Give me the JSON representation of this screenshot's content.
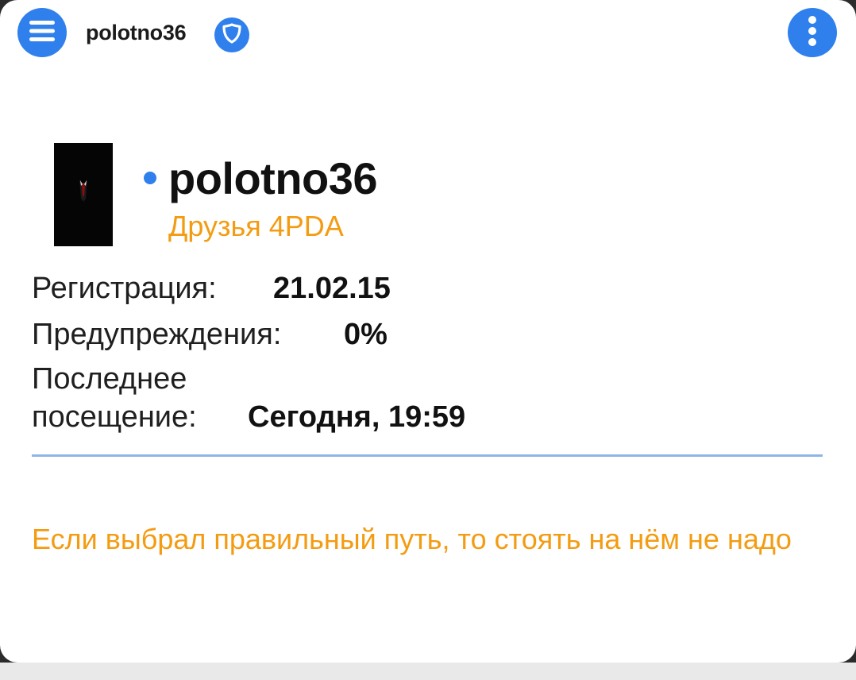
{
  "header": {
    "menu_icon": "hamburger-menu-icon",
    "username": "polotno36",
    "badge_icon": "shield-icon",
    "more_icon": "vertical-dots-icon"
  },
  "profile": {
    "name": "polotno36",
    "group": "Друзья 4PDA",
    "online": true,
    "avatar_icon": "avatar-image"
  },
  "info": {
    "registration_label": "Регистрация:",
    "registration_value": "21.02.15",
    "warnings_label": "Предупреждения:",
    "warnings_value": "0%",
    "last_visit_label_line1": "Последнее",
    "last_visit_label_line2": "посещение:",
    "last_visit_value": "Сегодня, 19:59"
  },
  "signature": "Если выбрал правильный путь, то стоять на нём не надо",
  "colors": {
    "accent": "#2f80ed",
    "group": "#f39c12",
    "divider": "#8fb3e6"
  }
}
